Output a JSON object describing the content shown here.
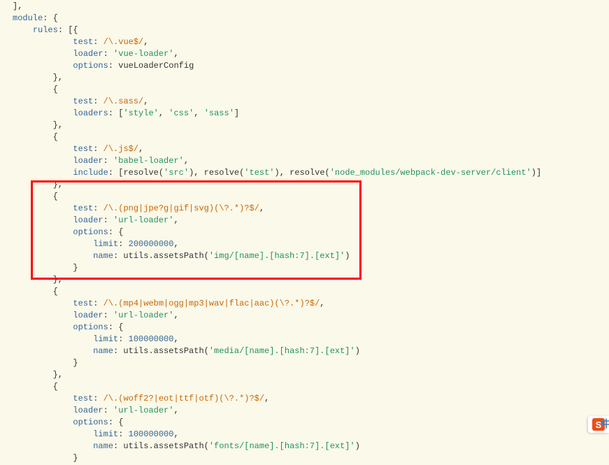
{
  "code": {
    "l1": "],",
    "l2a": "module",
    "l2b": ": {",
    "l3a": "rules",
    "l3b": ": [{",
    "l4a": "test",
    "l4b": ": ",
    "l4c": "/\\.vue$/",
    "l4d": ",",
    "l5a": "loader",
    "l5b": ": ",
    "l5c": "'vue-loader'",
    "l5d": ",",
    "l6a": "options",
    "l6b": ": vueLoaderConfig",
    "l7": "},",
    "l8": "{",
    "l9a": "test",
    "l9b": ": ",
    "l9c": "/\\.sass/",
    "l9d": ",",
    "l10a": "loaders",
    "l10b": ": [",
    "l10c": "'style'",
    "l10d": ", ",
    "l10e": "'css'",
    "l10f": ", ",
    "l10g": "'sass'",
    "l10h": "]",
    "l11": "},",
    "l12": "{",
    "l13a": "test",
    "l13b": ": ",
    "l13c": "/\\.js$/",
    "l13d": ",",
    "l14a": "loader",
    "l14b": ": ",
    "l14c": "'babel-loader'",
    "l14d": ",",
    "l15a": "include",
    "l15b": ": [resolve(",
    "l15c": "'src'",
    "l15d": "), resolve(",
    "l15e": "'test'",
    "l15f": "), resolve(",
    "l15g": "'node_modules/webpack-dev-server/client'",
    "l15h": ")]",
    "l16": "},",
    "l17": "{",
    "l18a": "test",
    "l18b": ": ",
    "l18c": "/\\.(png|jpe?g|gif|svg)(\\?.*)?$/",
    "l18d": ",",
    "l19a": "loader",
    "l19b": ": ",
    "l19c": "'url-loader'",
    "l19d": ",",
    "l20a": "options",
    "l20b": ": {",
    "l21a": "limit",
    "l21b": ": ",
    "l21c": "200000000",
    "l21d": ",",
    "l22a": "name",
    "l22b": ": utils.assetsPath(",
    "l22c": "'img/[name].[hash:7].[ext]'",
    "l22d": ")",
    "l23": "}",
    "l24": "},",
    "l25": "{",
    "l26a": "test",
    "l26b": ": ",
    "l26c": "/\\.(mp4|webm|ogg|mp3|wav|flac|aac)(\\?.*)?$/",
    "l26d": ",",
    "l27a": "loader",
    "l27b": ": ",
    "l27c": "'url-loader'",
    "l27d": ",",
    "l28a": "options",
    "l28b": ": {",
    "l29a": "limit",
    "l29b": ": ",
    "l29c": "100000000",
    "l29d": ",",
    "l30a": "name",
    "l30b": ": utils.assetsPath(",
    "l30c": "'media/[name].[hash:7].[ext]'",
    "l30d": ")",
    "l31": "}",
    "l32": "},",
    "l33": "{",
    "l34a": "test",
    "l34b": ": ",
    "l34c": "/\\.(woff2?|eot|ttf|otf)(\\?.*)?$/",
    "l34d": ",",
    "l35a": "loader",
    "l35b": ": ",
    "l35c": "'url-loader'",
    "l35d": ",",
    "l36a": "options",
    "l36b": ": {",
    "l37a": "limit",
    "l37b": ": ",
    "l37c": "100000000",
    "l37d": ",",
    "l38a": "name",
    "l38b": ": utils.assetsPath(",
    "l38c": "'fonts/[name].[hash:7].[ext]'",
    "l38d": ")",
    "l39": "}"
  },
  "badge": {
    "letter": "S",
    "txt": "中"
  }
}
